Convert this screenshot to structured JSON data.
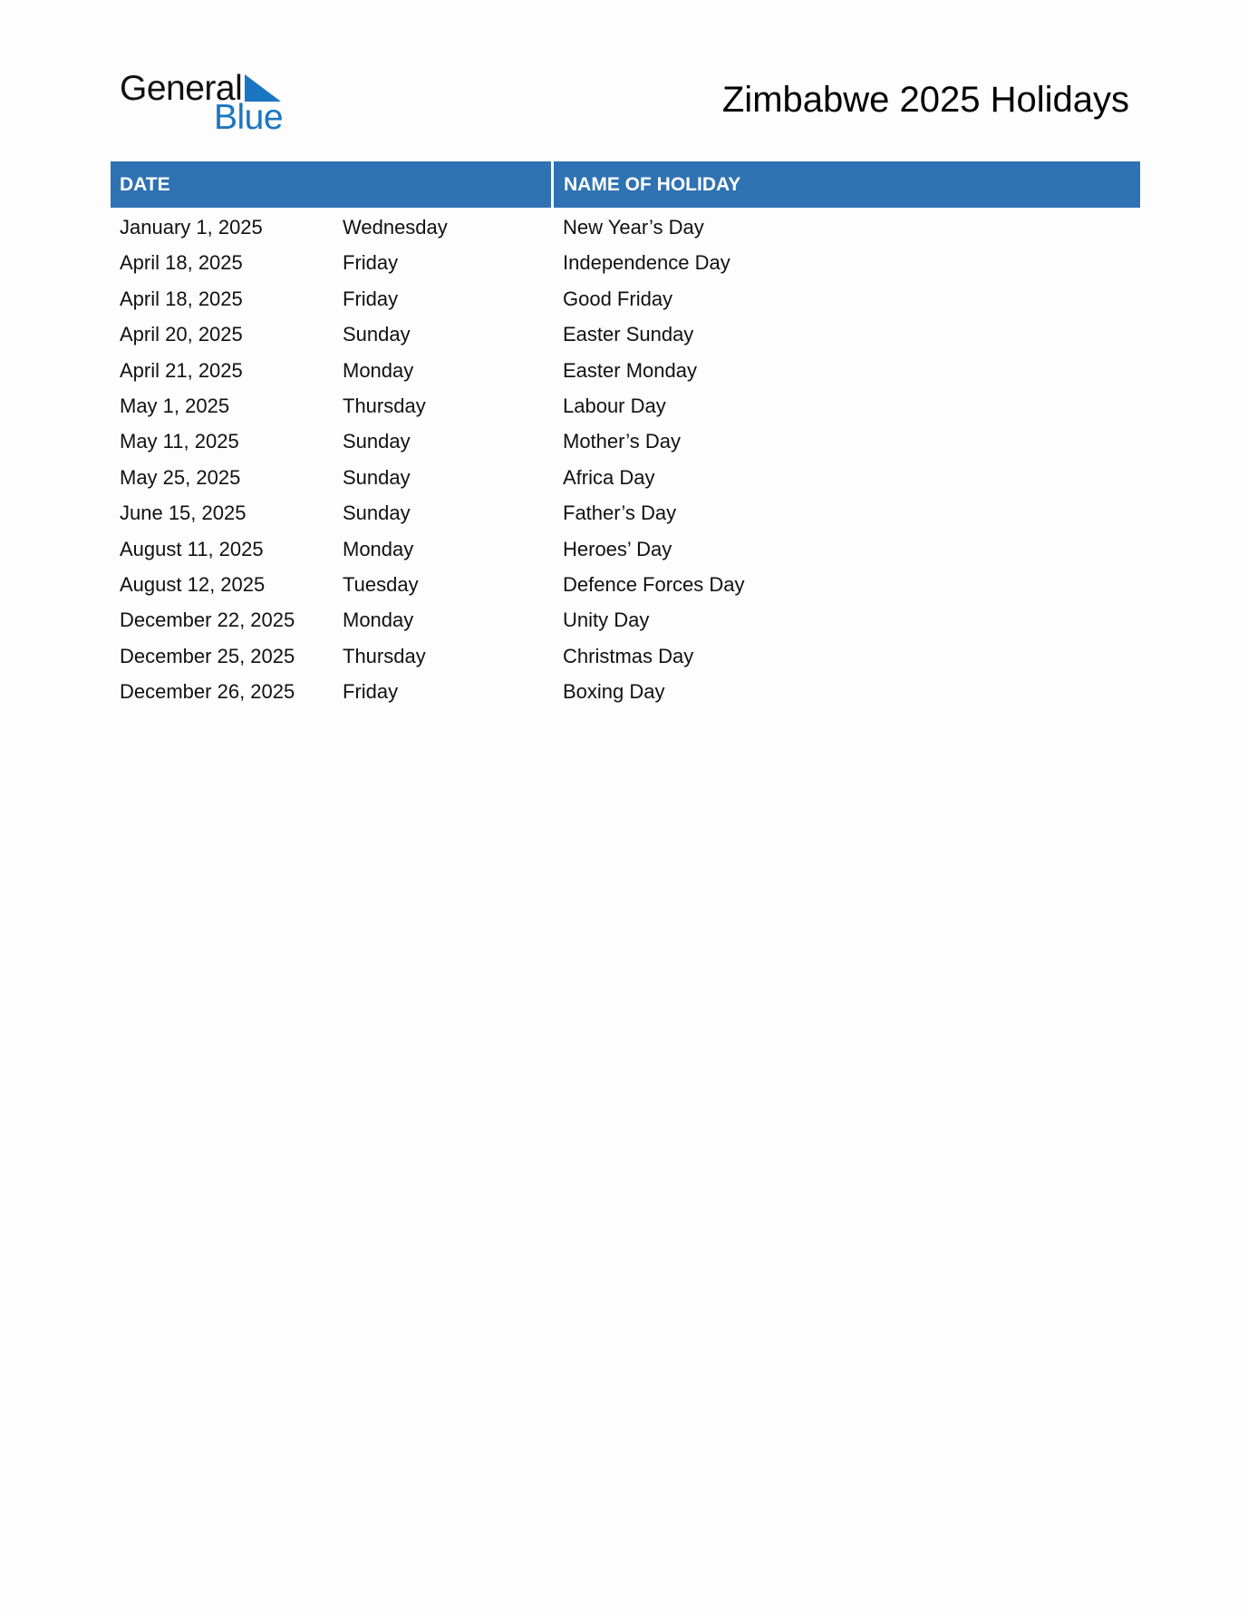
{
  "logo": {
    "word1": "General",
    "word2": "Blue",
    "icon": "triangle-icon",
    "accent_color": "#1a75c2"
  },
  "title": "Zimbabwe 2025 Holidays",
  "table": {
    "header_color": "#2e72b3",
    "headers": {
      "date": "DATE",
      "name": "NAME OF HOLIDAY"
    },
    "rows": [
      {
        "date": "January 1, 2025",
        "weekday": "Wednesday",
        "name": "New Year’s Day"
      },
      {
        "date": "April 18, 2025",
        "weekday": "Friday",
        "name": "Independence Day"
      },
      {
        "date": "April 18, 2025",
        "weekday": "Friday",
        "name": "Good Friday"
      },
      {
        "date": "April 20, 2025",
        "weekday": "Sunday",
        "name": "Easter Sunday"
      },
      {
        "date": "April 21, 2025",
        "weekday": "Monday",
        "name": "Easter Monday"
      },
      {
        "date": "May 1, 2025",
        "weekday": "Thursday",
        "name": "Labour Day"
      },
      {
        "date": "May 11, 2025",
        "weekday": "Sunday",
        "name": "Mother’s Day"
      },
      {
        "date": "May 25, 2025",
        "weekday": "Sunday",
        "name": "Africa Day"
      },
      {
        "date": "June 15, 2025",
        "weekday": "Sunday",
        "name": "Father’s Day"
      },
      {
        "date": "August 11, 2025",
        "weekday": "Monday",
        "name": "Heroes’ Day"
      },
      {
        "date": "August 12, 2025",
        "weekday": "Tuesday",
        "name": "Defence Forces Day"
      },
      {
        "date": "December 22, 2025",
        "weekday": "Monday",
        "name": "Unity Day"
      },
      {
        "date": "December 25, 2025",
        "weekday": "Thursday",
        "name": "Christmas Day"
      },
      {
        "date": "December 26, 2025",
        "weekday": "Friday",
        "name": "Boxing Day"
      }
    ]
  }
}
